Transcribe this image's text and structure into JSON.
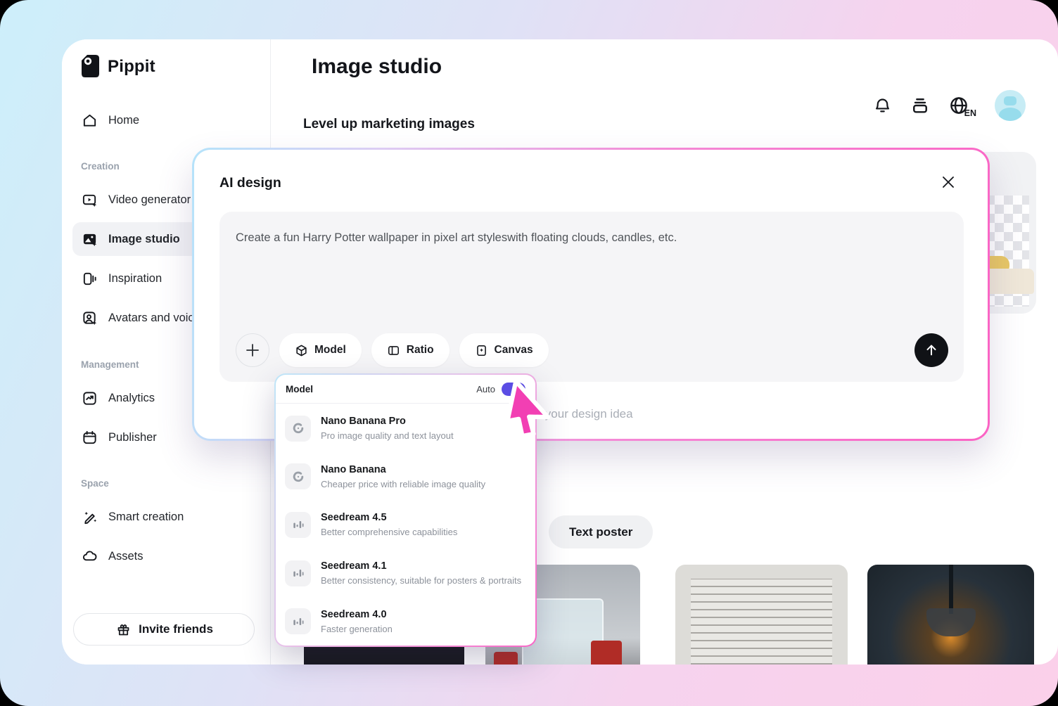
{
  "brand": "Pippit",
  "header": {
    "title": "Image studio",
    "lang_badge": "EN"
  },
  "sidebar": {
    "sections": {
      "creation": "Creation",
      "management": "Management",
      "space": "Space"
    },
    "items": {
      "home": "Home",
      "video": "Video generator",
      "image": "Image studio",
      "inspiration": "Inspiration",
      "avatars": "Avatars and voices",
      "analytics": "Analytics",
      "publisher": "Publisher",
      "smart": "Smart creation",
      "assets": "Assets"
    },
    "invite": "Invite friends"
  },
  "main": {
    "heading": "Level up marketing images",
    "text_poster": "Text poster"
  },
  "modal": {
    "title": "AI design",
    "prompt": "Create a fun Harry Potter wallpaper in pixel art styleswith floating clouds, candles, etc.",
    "model_btn": "Model",
    "ratio_btn": "Ratio",
    "canvas_btn": "Canvas",
    "placeholder": "Describe your design idea"
  },
  "model_menu": {
    "title": "Model",
    "auto_label": "Auto",
    "auto_on": true,
    "items": [
      {
        "name": "Nano Banana Pro",
        "desc": "Pro image quality and text layout"
      },
      {
        "name": "Nano Banana",
        "desc": "Cheaper price with reliable image quality"
      },
      {
        "name": "Seedream 4.5",
        "desc": "Better comprehensive capabilities"
      },
      {
        "name": "Seedream 4.1",
        "desc": "Better consistency, suitable for posters & portraits"
      },
      {
        "name": "Seedream 4.0",
        "desc": "Faster generation"
      }
    ]
  },
  "colors": {
    "toggle_purple": "#5b4de4",
    "cursor_pink": "#f23fb3",
    "border_blue": "#b5e3fa",
    "border_pink": "#fb63c4",
    "avatar_blue": "#c7ecf5",
    "background_gradient_start": "#cdeffa",
    "background_gradient_end": "#fbd0ea"
  }
}
